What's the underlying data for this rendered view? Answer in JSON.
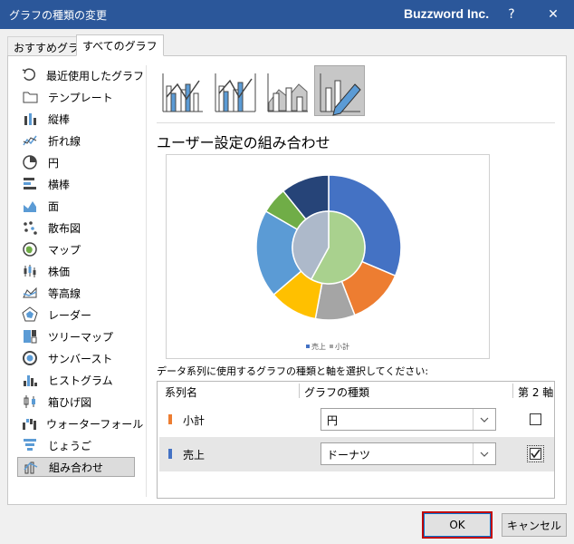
{
  "window": {
    "title": "グラフの種類の変更",
    "brand": "Buzzword Inc.",
    "help_label": "?",
    "close_label": "✕"
  },
  "tabs": [
    {
      "label": "おすすめグラフ",
      "selected": false
    },
    {
      "label": "すべてのグラフ",
      "selected": true
    }
  ],
  "categories": [
    {
      "label": "最近使用したグラフ",
      "icon": "recent-icon"
    },
    {
      "label": "テンプレート",
      "icon": "folder-icon"
    },
    {
      "label": "縦棒",
      "icon": "column-chart-icon"
    },
    {
      "label": "折れ線",
      "icon": "line-chart-icon"
    },
    {
      "label": "円",
      "icon": "pie-chart-icon"
    },
    {
      "label": "横棒",
      "icon": "bar-chart-icon"
    },
    {
      "label": "面",
      "icon": "area-chart-icon"
    },
    {
      "label": "散布図",
      "icon": "scatter-chart-icon"
    },
    {
      "label": "マップ",
      "icon": "map-icon"
    },
    {
      "label": "株価",
      "icon": "stock-chart-icon"
    },
    {
      "label": "等高線",
      "icon": "surface-chart-icon"
    },
    {
      "label": "レーダー",
      "icon": "radar-chart-icon"
    },
    {
      "label": "ツリーマップ",
      "icon": "treemap-icon"
    },
    {
      "label": "サンバースト",
      "icon": "sunburst-icon"
    },
    {
      "label": "ヒストグラム",
      "icon": "histogram-icon"
    },
    {
      "label": "箱ひげ図",
      "icon": "boxplot-icon"
    },
    {
      "label": "ウォーターフォール",
      "icon": "waterfall-icon"
    },
    {
      "label": "じょうご",
      "icon": "funnel-icon"
    },
    {
      "label": "組み合わせ",
      "icon": "combo-chart-icon",
      "selected": true
    }
  ],
  "subtypes": [
    {
      "icon": "clustered-column-line-icon"
    },
    {
      "icon": "clustered-column-line-secondary-axis-icon"
    },
    {
      "icon": "stacked-area-clustered-column-icon"
    },
    {
      "icon": "custom-combination-icon",
      "selected": true
    }
  ],
  "heading": "ユーザー設定の組み合わせ",
  "preview": {
    "legend": [
      {
        "label": "売上",
        "color": "#4472c4"
      },
      {
        "label": "小計",
        "color": "#a5a5a5"
      }
    ]
  },
  "chart_data": {
    "type": "pie",
    "series": [
      {
        "name": "売上",
        "chart": "donut",
        "values": [
          32,
          13,
          9,
          11,
          20,
          6,
          11
        ],
        "colors": [
          "#4472c4",
          "#ed7d31",
          "#a5a5a5",
          "#ffc000",
          "#5b9bd5",
          "#70ad47",
          "#264478"
        ]
      },
      {
        "name": "小計",
        "chart": "pie",
        "values": [
          58,
          42
        ],
        "colors": [
          "#a9d18e",
          "#adb9ca"
        ]
      }
    ]
  },
  "instruction": "データ系列に使用するグラフの種類と軸を選択してください:",
  "table": {
    "headers": {
      "name": "系列名",
      "type": "グラフの種類",
      "axis": "第 2 軸"
    },
    "rows": [
      {
        "name": "小計",
        "type": "円",
        "secondary": false,
        "color": "#ed7d31"
      },
      {
        "name": "売上",
        "type": "ドーナツ",
        "secondary": true,
        "color": "#4472c4"
      }
    ]
  },
  "buttons": {
    "ok": "OK",
    "cancel": "キャンセル"
  }
}
